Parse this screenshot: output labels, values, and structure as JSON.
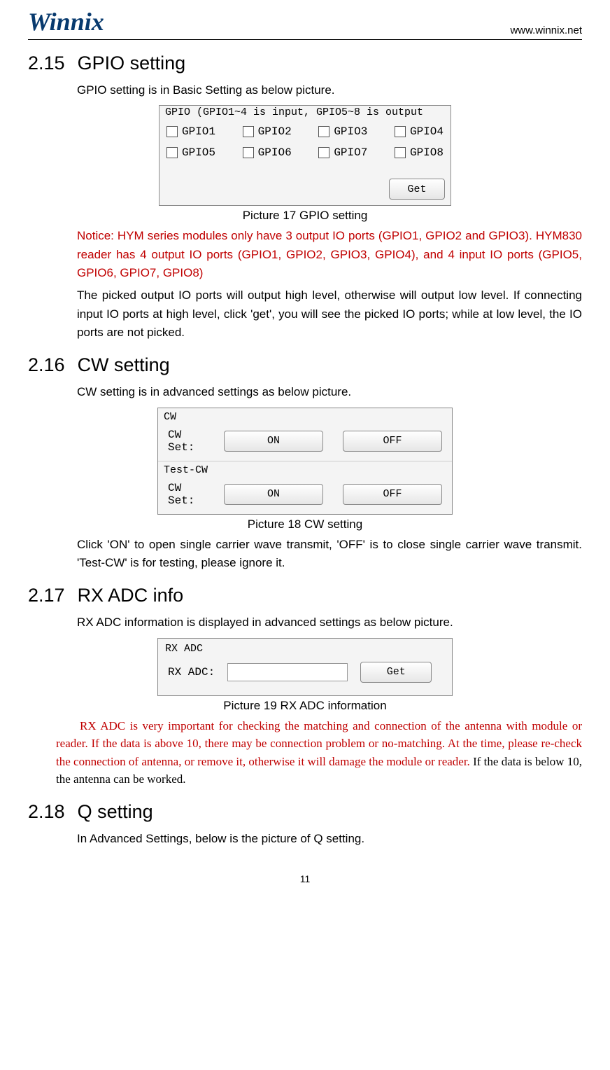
{
  "header": {
    "logo_text": "Winnix",
    "url": "www.winnix.net"
  },
  "sections": {
    "gpio": {
      "num": "2.15",
      "title": "GPIO setting",
      "intro": "GPIO setting is in Basic Setting as below picture.",
      "figure": {
        "group_title": "GPIO (GPIO1~4 is input, GPIO5~8 is output",
        "items": [
          "GPIO1",
          "GPIO2",
          "GPIO3",
          "GPIO4",
          "GPIO5",
          "GPIO6",
          "GPIO7",
          "GPIO8"
        ],
        "get_btn": "Get"
      },
      "caption": "Picture 17 GPIO setting",
      "notice": "Notice: HYM series modules only have 3 output IO ports (GPIO1, GPIO2 and GPIO3). HYM830 reader has 4 output IO ports (GPIO1, GPIO2, GPIO3, GPIO4), and 4 input IO ports (GPIO5, GPIO6, GPIO7, GPIO8)",
      "desc": "The picked output IO ports will output high level, otherwise will output low level. If connecting input IO ports at high level, click 'get', you will see the picked IO ports; while at low level, the IO ports are not picked."
    },
    "cw": {
      "num": "2.16",
      "title": "CW setting",
      "intro": "CW setting is in advanced settings as below picture.",
      "figure": {
        "group1": "CW",
        "group2": "Test-CW",
        "row_label": "CW Set:",
        "on_btn": "ON",
        "off_btn": "OFF"
      },
      "caption": "Picture 18 CW setting",
      "desc": "Click 'ON' to open single carrier wave transmit, 'OFF' is to close single carrier wave transmit. 'Test-CW' is for testing, please ignore it."
    },
    "rxadc": {
      "num": "2.17",
      "title": "RX ADC info",
      "intro": "RX ADC information is displayed in advanced settings as below picture.",
      "figure": {
        "group": "RX ADC",
        "row_label": "RX ADC:",
        "get_btn": "Get"
      },
      "caption": "Picture 19 RX ADC information",
      "warn_red": "RX ADC is very important for checking the matching and connection of the antenna with module or reader. If the data is above 10, there may be connection problem or no-matching. At the time, please re-check the connection of antenna, or remove it, otherwise it will damage the module or reader.",
      "warn_black": " If the data is below 10, the antenna can be worked."
    },
    "q": {
      "num": "2.18",
      "title": "Q setting",
      "intro": "In Advanced Settings, below is the picture of Q setting."
    }
  },
  "page_number": "11"
}
